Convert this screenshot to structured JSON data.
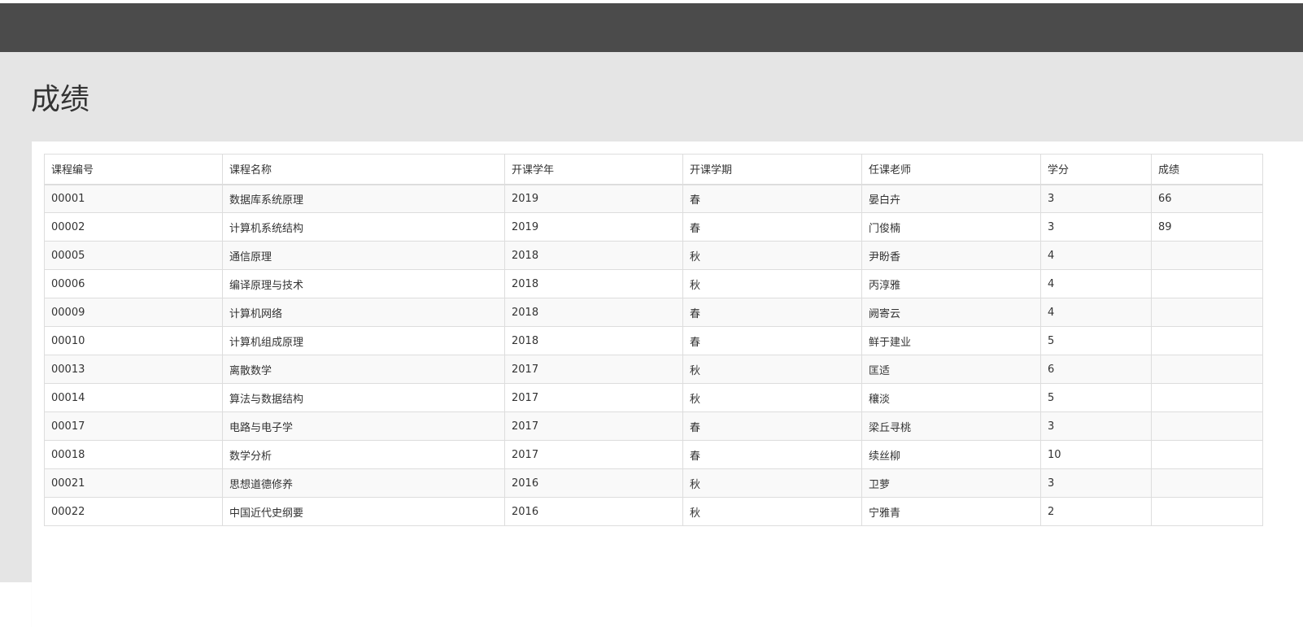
{
  "page": {
    "title": "成绩"
  },
  "table": {
    "columns": [
      "课程编号",
      "课程名称",
      "开课学年",
      "开课学期",
      "任课老师",
      "学分",
      "成绩"
    ],
    "rows": [
      [
        "00001",
        "数据库系统原理",
        "2019",
        "春",
        "晏白卉",
        "3",
        "66"
      ],
      [
        "00002",
        "计算机系统结构",
        "2019",
        "春",
        "门俊楠",
        "3",
        "89"
      ],
      [
        "00005",
        "通信原理",
        "2018",
        "秋",
        "尹盼香",
        "4",
        ""
      ],
      [
        "00006",
        "编译原理与技术",
        "2018",
        "秋",
        "丙淳雅",
        "4",
        ""
      ],
      [
        "00009",
        "计算机网络",
        "2018",
        "春",
        "阙寄云",
        "4",
        ""
      ],
      [
        "00010",
        "计算机组成原理",
        "2018",
        "春",
        "鲜于建业",
        "5",
        ""
      ],
      [
        "00013",
        "离散数学",
        "2017",
        "秋",
        "匡适",
        "6",
        ""
      ],
      [
        "00014",
        "算法与数据结构",
        "2017",
        "秋",
        "穰淡",
        "5",
        ""
      ],
      [
        "00017",
        "电路与电子学",
        "2017",
        "春",
        "梁丘寻桃",
        "3",
        ""
      ],
      [
        "00018",
        "数学分析",
        "2017",
        "春",
        "续丝柳",
        "10",
        ""
      ],
      [
        "00021",
        "思想道德修养",
        "2016",
        "秋",
        "卫萝",
        "3",
        ""
      ],
      [
        "00022",
        "中国近代史纲要",
        "2016",
        "秋",
        "宁雅青",
        "2",
        ""
      ]
    ]
  },
  "colors": {
    "topbar": "#4b4b4b",
    "page_background": "#e5e5e5",
    "card_background": "#ffffff",
    "border": "#dddddd",
    "stripe": "#f9f9f9"
  }
}
